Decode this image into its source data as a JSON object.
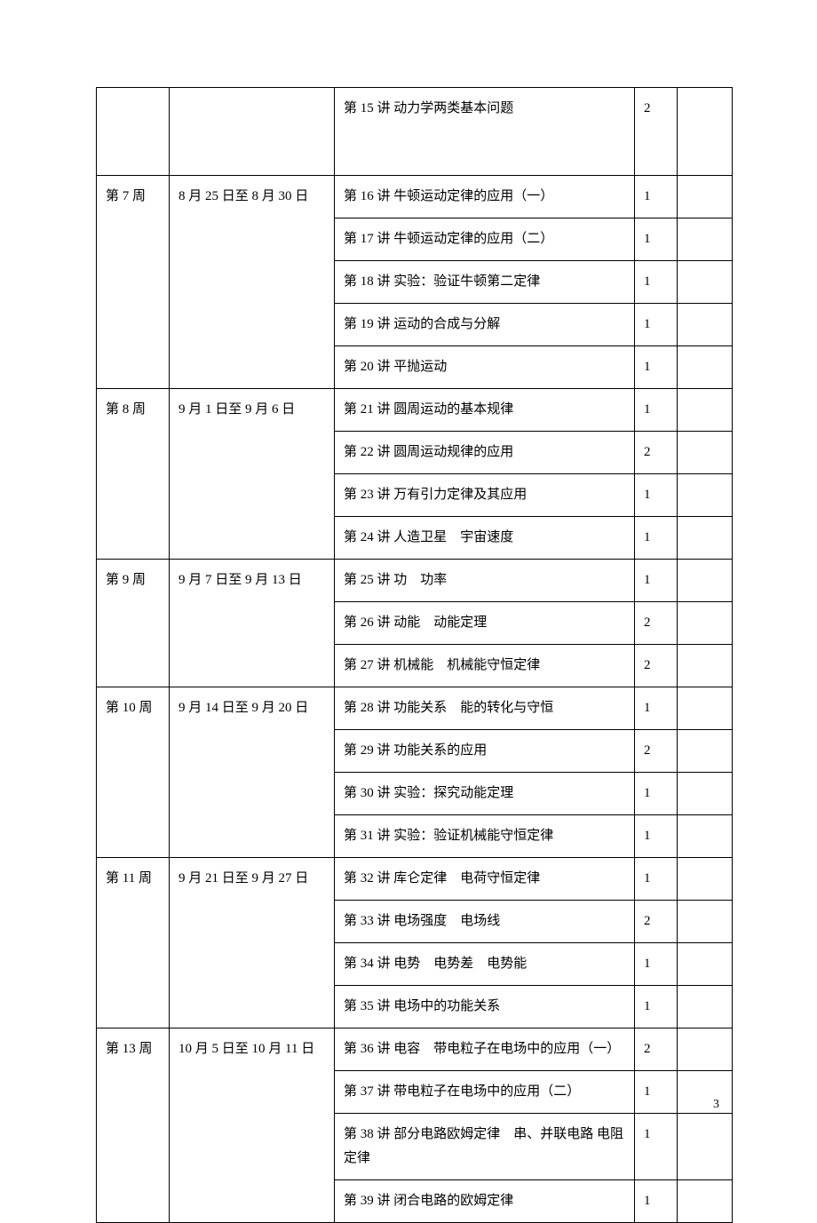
{
  "rows": [
    {
      "week": "",
      "dates": "",
      "topic": "第 15 讲 动力学两类基本问题",
      "hours": "2",
      "note": "",
      "tall": true,
      "showWeek": true,
      "weekSpan": 1
    },
    {
      "week": "第 7 周",
      "dates": "8 月 25 日至 8 月 30 日",
      "topic": "第 16 讲 牛顿运动定律的应用（一）",
      "hours": "1",
      "note": "",
      "showWeek": true,
      "weekSpan": 5
    },
    {
      "topic": "第 17 讲 牛顿运动定律的应用（二）",
      "hours": "1",
      "note": ""
    },
    {
      "topic": "第 18 讲 实验：验证牛顿第二定律",
      "hours": "1",
      "note": ""
    },
    {
      "topic": "第 19 讲 运动的合成与分解",
      "hours": "1",
      "note": ""
    },
    {
      "topic": "第 20 讲 平抛运动",
      "hours": "1",
      "note": ""
    },
    {
      "week": "第 8 周",
      "dates": "9 月 1 日至 9 月 6 日",
      "topic": "第 21 讲 圆周运动的基本规律",
      "hours": "1",
      "note": "",
      "showWeek": true,
      "weekSpan": 4
    },
    {
      "topic": "第 22 讲 圆周运动规律的应用",
      "hours": "2",
      "note": ""
    },
    {
      "topic": "第 23 讲 万有引力定律及其应用",
      "hours": "1",
      "note": ""
    },
    {
      "topic": "第 24 讲 人造卫星　宇宙速度",
      "hours": "1",
      "note": ""
    },
    {
      "week": "第 9 周",
      "dates": "9 月 7 日至 9 月 13 日",
      "topic": "第 25 讲 功　功率",
      "hours": "1",
      "note": "",
      "showWeek": true,
      "weekSpan": 3
    },
    {
      "topic": "第 26 讲 动能　动能定理",
      "hours": "2",
      "note": ""
    },
    {
      "topic": "第 27 讲 机械能　机械能守恒定律",
      "hours": "2",
      "note": ""
    },
    {
      "week": "第 10 周",
      "dates": "9 月 14 日至 9 月 20 日",
      "topic": "第 28 讲 功能关系　能的转化与守恒",
      "hours": "1",
      "note": "",
      "showWeek": true,
      "weekSpan": 4
    },
    {
      "topic": "第 29 讲 功能关系的应用",
      "hours": "2",
      "note": ""
    },
    {
      "topic": "第 30 讲 实验：探究动能定理",
      "hours": "1",
      "note": ""
    },
    {
      "topic": "第 31 讲 实验：验证机械能守恒定律",
      "hours": "1",
      "note": ""
    },
    {
      "week": "第 11 周",
      "dates": "9 月 21 日至 9 月 27 日",
      "topic": "第 32 讲 库仑定律　电荷守恒定律",
      "hours": "1",
      "note": "",
      "showWeek": true,
      "weekSpan": 4
    },
    {
      "topic": "第 33 讲 电场强度　电场线",
      "hours": "2",
      "note": ""
    },
    {
      "topic": "第 34 讲 电势　电势差　电势能",
      "hours": "1",
      "note": ""
    },
    {
      "topic": "第 35 讲 电场中的功能关系",
      "hours": "1",
      "note": ""
    },
    {
      "week": "第 13 周",
      "dates": "10 月 5 日至 10 月 11 日",
      "topic": "第 36 讲 电容　带电粒子在电场中的应用（一）",
      "hours": "2",
      "note": "",
      "showWeek": true,
      "weekSpan": 4
    },
    {
      "topic": "第 37 讲 带电粒子在电场中的应用（二）",
      "hours": "1",
      "note": ""
    },
    {
      "topic": "第 38 讲 部分电路欧姆定律　串、并联电路 电阻定律",
      "hours": "1",
      "note": ""
    },
    {
      "topic": "第 39 讲 闭合电路的欧姆定律",
      "hours": "1",
      "note": ""
    }
  ],
  "pageNumber": "3"
}
